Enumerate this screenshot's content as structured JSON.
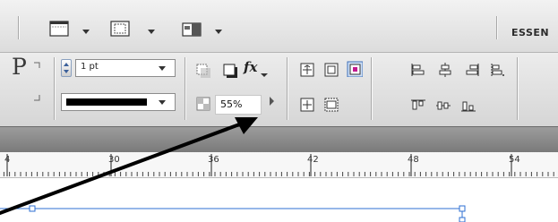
{
  "app_bar": {
    "workspace_label": "ESSEN",
    "frame_view_icon": "view-frame-icon",
    "screen_mode_icon": "screen-mode-icon",
    "arrange_icon": "arrange-documents-icon"
  },
  "control_panel": {
    "paragraph_glyph": "P",
    "stroke_weight": "1 pt",
    "stroke_type_preview": "solid-line",
    "opacity": "55%",
    "effects_label": "fx"
  },
  "ruler": {
    "marks": [
      "4",
      "30",
      "36",
      "42",
      "48",
      "54"
    ]
  },
  "colors": {
    "selection_blue": "#2d6fd3",
    "toolbar_gray": "#e4e4e4",
    "dark_strip": "#8a8a8a"
  }
}
